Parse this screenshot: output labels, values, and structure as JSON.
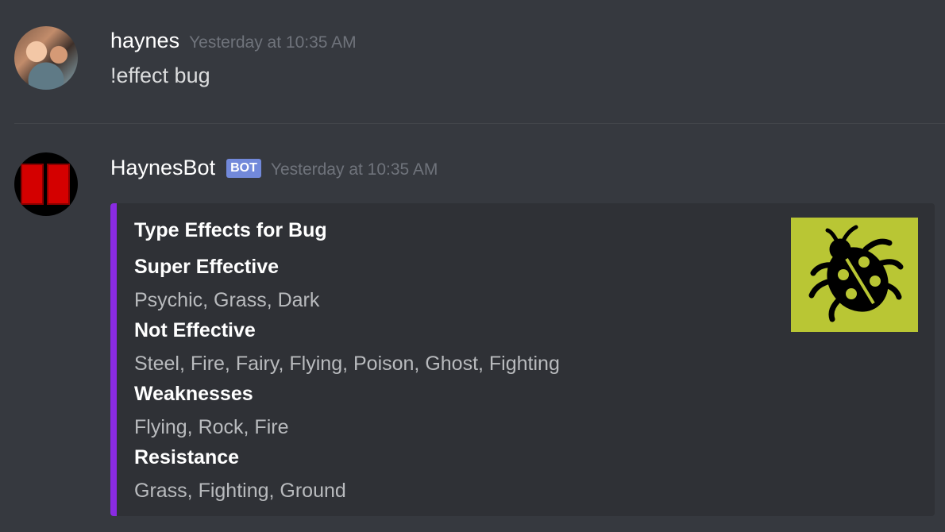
{
  "messages": [
    {
      "username": "haynes",
      "timestamp": "Yesterday at 10:35 AM",
      "text": "!effect bug"
    },
    {
      "username": "HaynesBot",
      "badge": "BOT",
      "timestamp": "Yesterday at 10:35 AM",
      "embed": {
        "accent_color": "#8a2be2",
        "title": "Type Effects for Bug",
        "thumbnail_icon": "ladybug-icon",
        "fields": [
          {
            "name": "Super Effective",
            "value": "Psychic, Grass, Dark"
          },
          {
            "name": "Not Effective",
            "value": "Steel, Fire, Fairy, Flying, Poison, Ghost, Fighting"
          },
          {
            "name": "Weaknesses",
            "value": "Flying, Rock, Fire"
          },
          {
            "name": "Resistance",
            "value": "Grass, Fighting, Ground"
          }
        ]
      }
    }
  ]
}
